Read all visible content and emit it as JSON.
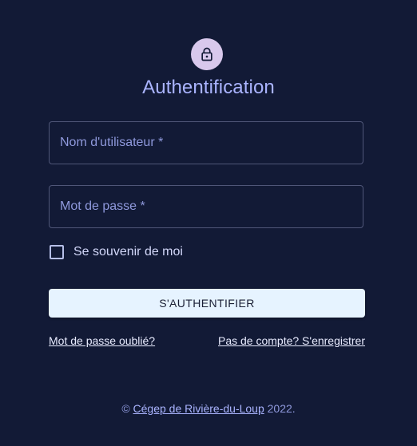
{
  "header": {
    "icon": "lock-icon",
    "title": "Authentification"
  },
  "form": {
    "username": {
      "placeholder": "Nom d'utilisateur *",
      "value": ""
    },
    "password": {
      "placeholder": "Mot de passe *",
      "value": ""
    },
    "remember": {
      "label": "Se souvenir de moi",
      "checked": false
    },
    "submit_label": "S'AUTHENTIFIER"
  },
  "links": {
    "forgot": "Mot de passe oublié?",
    "register": "Pas de compte? S'enregistrer"
  },
  "footer": {
    "copyright": "©",
    "org": "Cégep de Rivière-du-Loup",
    "year": "2022."
  },
  "colors": {
    "background": "#121a36",
    "accent": "#aab4ff",
    "avatar": "#d8c8ec",
    "button": "#e6f3ff"
  }
}
